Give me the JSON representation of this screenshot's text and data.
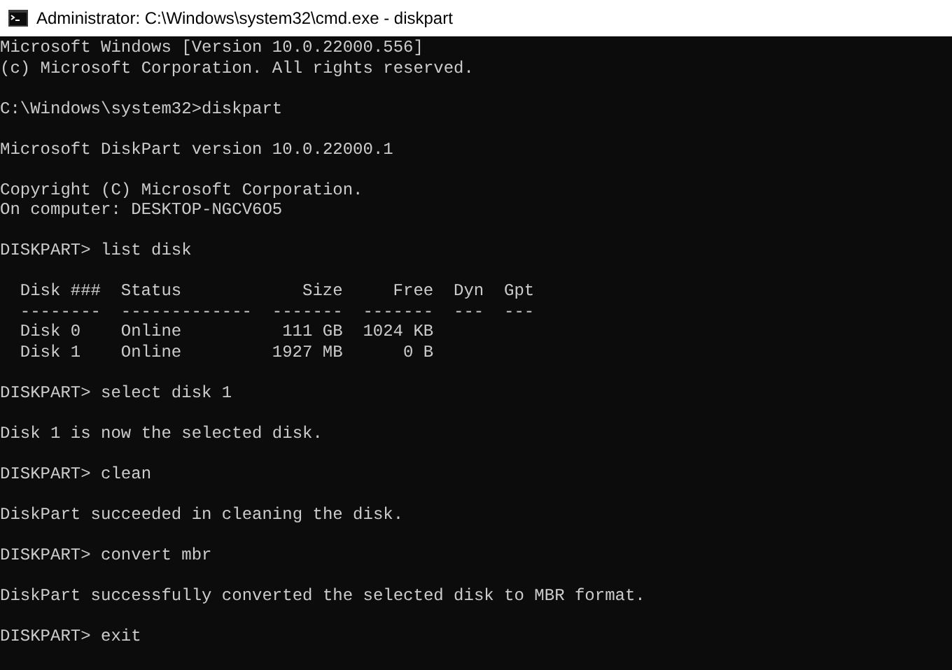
{
  "window": {
    "title": "Administrator: C:\\Windows\\system32\\cmd.exe - diskpart"
  },
  "console": [
    {
      "kind": "text",
      "lines": [
        "Microsoft Windows [Version 10.0.22000.556]",
        "(c) Microsoft Corporation. All rights reserved."
      ]
    },
    {
      "kind": "text",
      "lines": [
        "C:\\Windows\\system32>diskpart"
      ]
    },
    {
      "kind": "text",
      "lines": [
        "Microsoft DiskPart version 10.0.22000.1"
      ]
    },
    {
      "kind": "text",
      "lines": [
        "Copyright (C) Microsoft Corporation.",
        "On computer: DESKTOP-NGCV6O5"
      ]
    },
    {
      "kind": "text",
      "lines": [
        "DISKPART> list disk"
      ]
    },
    {
      "kind": "table",
      "columns": [
        "Disk ###",
        "Status",
        "Size",
        "Free",
        "Dyn",
        "Gpt"
      ],
      "separators": [
        "--------",
        "-------------",
        "-------",
        "-------",
        "---",
        "---"
      ],
      "rows": [
        [
          "Disk 0",
          "Online",
          "111 GB",
          "1024 KB",
          "",
          ""
        ],
        [
          "Disk 1",
          "Online",
          "1927 MB",
          "0 B",
          "",
          ""
        ]
      ]
    },
    {
      "kind": "text",
      "lines": [
        "DISKPART> select disk 1"
      ]
    },
    {
      "kind": "text",
      "lines": [
        "Disk 1 is now the selected disk."
      ]
    },
    {
      "kind": "text",
      "lines": [
        "DISKPART> clean"
      ]
    },
    {
      "kind": "text",
      "lines": [
        "DiskPart succeeded in cleaning the disk."
      ]
    },
    {
      "kind": "text",
      "lines": [
        "DISKPART> convert mbr"
      ]
    },
    {
      "kind": "text",
      "lines": [
        "DiskPart successfully converted the selected disk to MBR format."
      ]
    },
    {
      "kind": "text",
      "lines": [
        "DISKPART> exit"
      ]
    }
  ]
}
